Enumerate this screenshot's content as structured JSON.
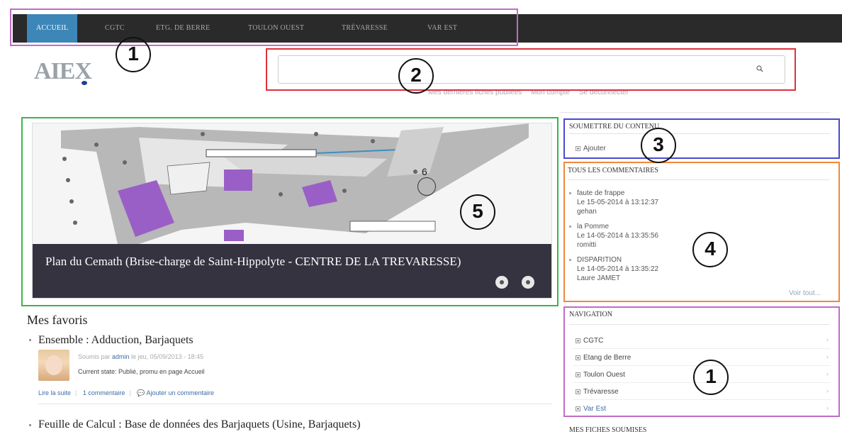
{
  "topnav": {
    "tabs": [
      {
        "label": "ACCUEIL",
        "active": true
      },
      {
        "label": "CGTC"
      },
      {
        "label": "ETG. DE BERRE"
      },
      {
        "label": "TOULON OUEST"
      },
      {
        "label": "TRÉVARESSE"
      },
      {
        "label": "VAR EST"
      }
    ]
  },
  "logo": {
    "text": "AIEX"
  },
  "search": {
    "placeholder": "",
    "icon": "search-icon"
  },
  "user_links": [
    "Mes dernières fiches publiées",
    "Mon compte",
    "Se déconnecter"
  ],
  "slider": {
    "caption": "Plan du Cemath (Brise-charge de Saint-Hippolyte - CENTRE DE LA TREVARESSE)",
    "prev_icon": "prev-icon",
    "next_icon": "next-icon"
  },
  "favorites": {
    "title": "Mes favoris",
    "entries": [
      {
        "title": "Ensemble : Adduction, Barjaquets",
        "meta_prefix": "Soumis par",
        "author": "admin",
        "meta_suffix": "le jeu, 05/09/2013 - 18:45",
        "state": "Current state: Publié, promu en page Accueil",
        "read_more": "Lire la suite",
        "comments": "1 commentaire",
        "add_comment": "Ajouter un commentaire"
      },
      {
        "title": "Feuille de Calcul : Base de données des Barjaquets (Usine, Barjaquets)"
      }
    ]
  },
  "sidebar": {
    "submit": {
      "title": "SOUMETTRE DU CONTENU",
      "add_label": "Ajouter"
    },
    "comments": {
      "title": "TOUS LES COMMENTAIRES",
      "items": [
        {
          "subject": "faute de frappe",
          "date": "Le 15-05-2014 à 13:12:37",
          "author": "gehan"
        },
        {
          "subject": "la Pomme",
          "date": "Le 14-05-2014 à 13:35:56",
          "author": "romitti"
        },
        {
          "subject": "DISPARITION",
          "date": "Le 14-05-2014 à 13:35:22",
          "author": "Laure JAMET"
        }
      ],
      "see_all": "Voir tout..."
    },
    "navigation": {
      "title": "NAVIGATION",
      "items": [
        "CGTC",
        "Etang de Berre",
        "Toulon Ouest",
        "Trévaresse",
        "Var Est"
      ]
    },
    "my_sheets": {
      "title": "MES FICHES SOUMISES"
    }
  },
  "annotations": {
    "labels": [
      "1",
      "2",
      "3",
      "4",
      "5",
      "1"
    ],
    "small_label": "6"
  },
  "colors": {
    "nav_bg": "#2a2a2a",
    "nav_active": "#3d86b8",
    "caption_bg": "#353340",
    "ann_purple": "#c06cc8",
    "ann_red": "#e0303a",
    "ann_green": "#3cb44b",
    "ann_blue": "#4a4ad0",
    "ann_orange": "#f0883a"
  }
}
